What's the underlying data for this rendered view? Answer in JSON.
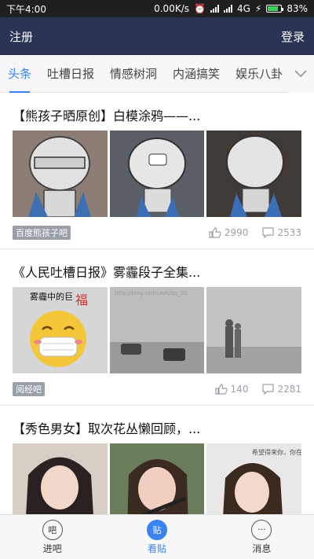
{
  "status_bar": {
    "time": "下午4:00",
    "network_speed": "0.00K/s",
    "network_type": "4G",
    "battery": "83%",
    "battery_level": 0.83
  },
  "header": {
    "left_label": "注册",
    "right_label": "登录"
  },
  "tabs": {
    "items": [
      "头条",
      "吐槽日报",
      "情感树洞",
      "内涵搞笑",
      "娱乐八卦"
    ],
    "active_index": 0
  },
  "feed": {
    "cards": [
      {
        "title": "【熊孩子晒原创】白模涂鸦——...",
        "source": "百度熊孩子吧",
        "likes": "2990",
        "comments": "2533"
      },
      {
        "title": "《人民吐槽日报》雾霾段子全集...",
        "source": "阅经吧",
        "likes": "140",
        "comments": "2281",
        "image_caption": "雾霾中的巨",
        "image_stamp": "福",
        "watermark": "http://blog.csdn.net/qq_20"
      },
      {
        "title": "【秀色男女】取次花丛懒回顾，...",
        "image_note": "希望得来你，你在呢？"
      }
    ]
  },
  "bottom_nav": {
    "items": [
      {
        "icon_text": "吧",
        "label": "进吧"
      },
      {
        "icon_text": "贴",
        "label": "看贴"
      },
      {
        "icon_text": "···",
        "label": "消息"
      }
    ],
    "active_index": 1
  },
  "colors": {
    "header_bg": "#2a3353",
    "accent": "#3a82f7",
    "status_bg": "#1f1f1f",
    "badge_bg": "#9aa0a8"
  }
}
